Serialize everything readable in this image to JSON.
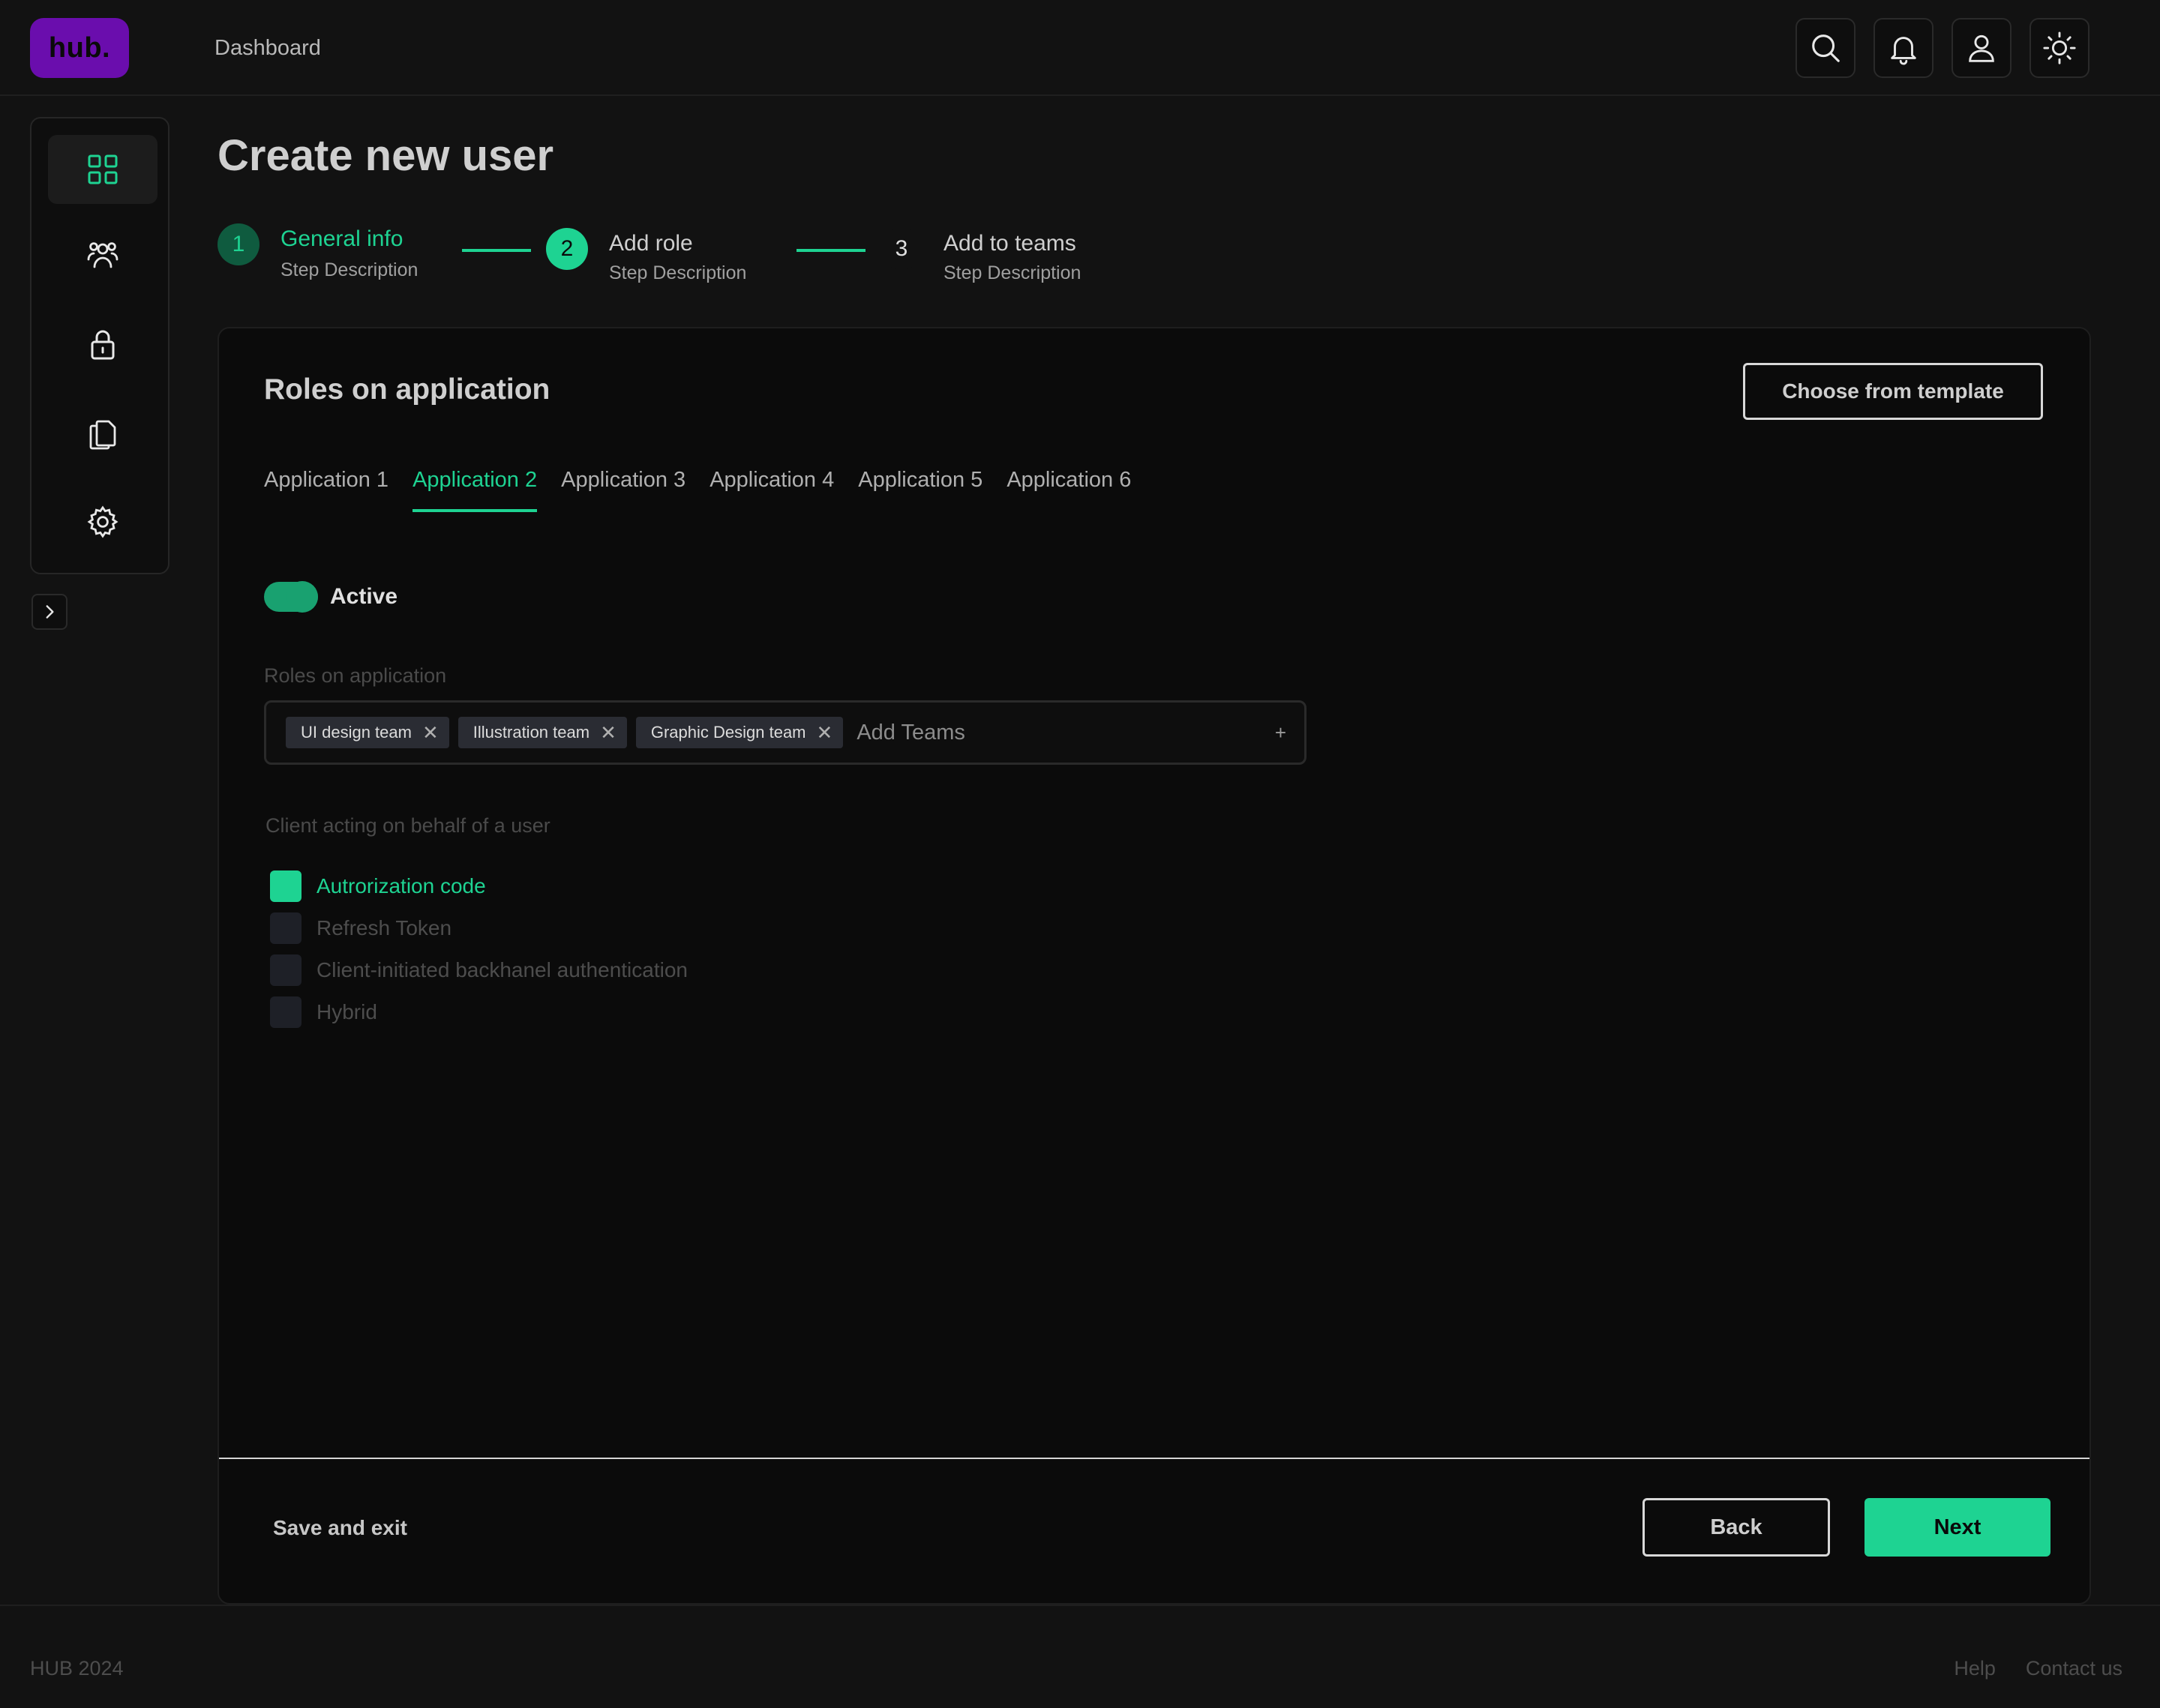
{
  "brand": {
    "logo_text": "hub.",
    "logo_color": "#6a0dad",
    "accent_color": "#1ed392"
  },
  "topbar": {
    "nav_label": "Dashboard",
    "icons": [
      "search-icon",
      "bell-icon",
      "user-icon",
      "sun-icon"
    ]
  },
  "sidebar": {
    "items": [
      {
        "icon": "grid-icon",
        "active": true
      },
      {
        "icon": "users-icon",
        "active": false
      },
      {
        "icon": "lock-icon",
        "active": false
      },
      {
        "icon": "documents-icon",
        "active": false
      },
      {
        "icon": "gear-icon",
        "active": false
      }
    ],
    "expand_icon": "chevron-right-icon"
  },
  "page": {
    "title": "Create new user"
  },
  "stepper": {
    "steps": [
      {
        "number": "1",
        "title": "General info",
        "description": "Step Description",
        "state": "completed"
      },
      {
        "number": "2",
        "title": "Add role",
        "description": "Step Description",
        "state": "current"
      },
      {
        "number": "3",
        "title": "Add to teams",
        "description": "Step Description",
        "state": "upcoming"
      }
    ]
  },
  "card": {
    "title": "Roles on application",
    "template_button": "Choose from template",
    "tabs": [
      "Application 1",
      "Application 2",
      "Application 3",
      "Application 4",
      "Application 5",
      "Application 6"
    ],
    "active_tab": "Application 2",
    "toggle": {
      "label": "Active",
      "on": true
    },
    "roles_label": "Roles on application",
    "tags": [
      "UI design team",
      "Illustration team",
      "Graphic Design team"
    ],
    "tag_remove": "✕",
    "tags_placeholder": "Add Teams",
    "tags_add": "+",
    "client_label": "Client acting on behalf of a user",
    "checkboxes": [
      {
        "label": "Autrorization code",
        "checked": true
      },
      {
        "label": "Refresh Token",
        "checked": false
      },
      {
        "label": "Client-initiated backhanel authentication",
        "checked": false
      },
      {
        "label": "Hybrid",
        "checked": false
      }
    ],
    "save_exit": "Save and exit",
    "back": "Back",
    "next": "Next"
  },
  "footer": {
    "left": "HUB 2024",
    "links": [
      "Help",
      "Contact us"
    ]
  }
}
